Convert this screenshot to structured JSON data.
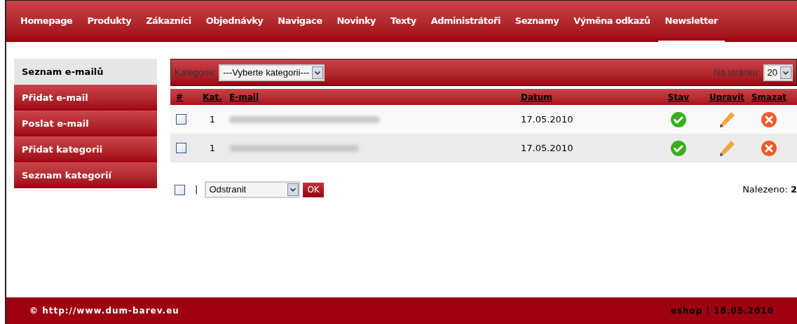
{
  "nav": [
    {
      "label": "Homepage",
      "selected": false
    },
    {
      "label": "Produkty",
      "selected": false
    },
    {
      "label": "Zákazníci",
      "selected": false
    },
    {
      "label": "Objednávky",
      "selected": false
    },
    {
      "label": "Navigace",
      "selected": false
    },
    {
      "label": "Novinky",
      "selected": false
    },
    {
      "label": "Texty",
      "selected": false
    },
    {
      "label": "Administrátoři",
      "selected": false
    },
    {
      "label": "Seznamy",
      "selected": false
    },
    {
      "label": "Výměna odkazů",
      "selected": false
    },
    {
      "label": "Newsletter",
      "selected": true
    }
  ],
  "sidebar": {
    "items": [
      {
        "label": "Seznam e-mailů",
        "selected": true
      },
      {
        "label": "Přidat e-mail",
        "selected": false
      },
      {
        "label": "Poslat e-mail",
        "selected": false
      },
      {
        "label": "Přidat kategorii",
        "selected": false
      },
      {
        "label": "Seznam kategorií",
        "selected": false
      }
    ]
  },
  "filter": {
    "category_label": "Kategorie:",
    "category_value": "---Vyberte kategorii---",
    "per_page_label": "Na stránku:",
    "per_page_value": "20"
  },
  "table": {
    "columns": [
      "#",
      "Kat.",
      "E-mail",
      "Datum",
      "Stav",
      "Upravit",
      "Smazat"
    ],
    "rows": [
      {
        "checked": false,
        "category": "1",
        "date": "17.05.2010",
        "active": true
      },
      {
        "checked": false,
        "category": "1",
        "date": "17.05.2010",
        "active": true
      }
    ]
  },
  "bulk": {
    "checked": false,
    "separator": "|",
    "action": "Odstranit",
    "submit": "OK",
    "found_label": "Nalezeno:",
    "found_count": "2"
  },
  "footer": {
    "left": "© http://www.dum-barev.eu",
    "right": "eshop | 18.05.2010"
  }
}
